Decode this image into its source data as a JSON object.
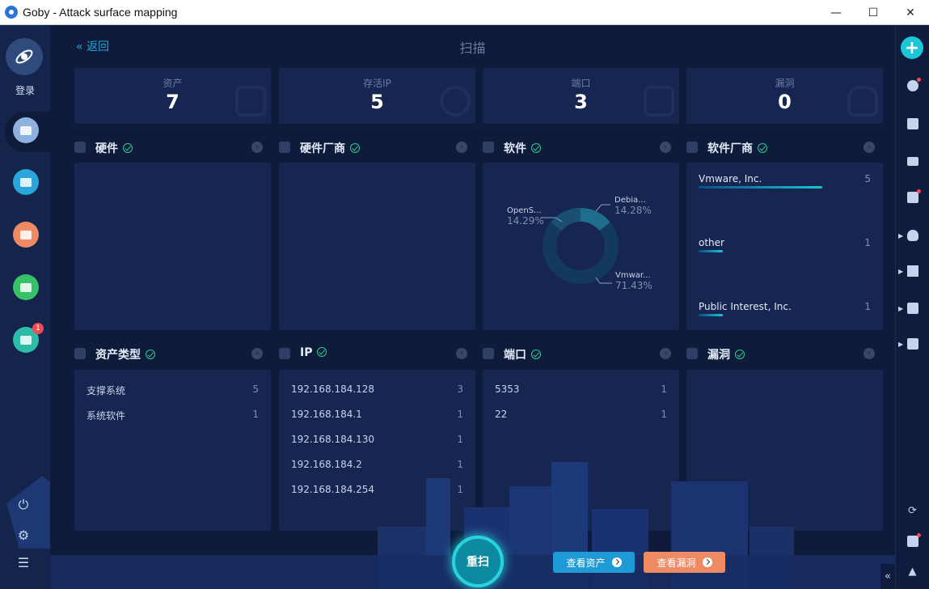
{
  "window": {
    "title": "Goby - Attack surface mapping",
    "minimize": "—",
    "maximize": "☐",
    "close": "✕"
  },
  "sidebar": {
    "login_label": "登录",
    "plugin_badge": "1"
  },
  "header": {
    "back_label": "« 返回",
    "page_title": "扫描"
  },
  "stats": [
    {
      "label": "资产",
      "value": "7",
      "icon": "layers-icon"
    },
    {
      "label": "存活IP",
      "value": "5",
      "icon": "ip-icon"
    },
    {
      "label": "端口",
      "value": "3",
      "icon": "port-icon"
    },
    {
      "label": "漏洞",
      "value": "0",
      "icon": "bug-icon"
    }
  ],
  "panels": {
    "hardware": {
      "title": "硬件"
    },
    "hardware_vendor": {
      "title": "硬件厂商"
    },
    "software": {
      "title": "软件",
      "chart_data": {
        "type": "pie",
        "style": "donut",
        "slices": [
          {
            "label": "Debia...",
            "value": 14.28,
            "display": "14.28%"
          },
          {
            "label": "OpenS...",
            "value": 14.29,
            "display": "14.29%"
          },
          {
            "label": "Vmwar...",
            "value": 71.43,
            "display": "71.43%"
          }
        ],
        "colors": [
          "#1e6d8c",
          "#1a4f73",
          "#133a5e"
        ]
      }
    },
    "software_vendor": {
      "title": "软件厂商",
      "items": [
        {
          "name": "Vmware, Inc.",
          "count": "5",
          "ratio": 0.71
        },
        {
          "name": "other",
          "count": "1",
          "ratio": 0.14
        },
        {
          "name": "Public Interest, Inc.",
          "count": "1",
          "ratio": 0.14
        }
      ]
    },
    "asset_type": {
      "title": "资产类型",
      "rows": [
        {
          "k": "支撑系统",
          "v": "5"
        },
        {
          "k": "系统软件",
          "v": "1"
        }
      ]
    },
    "ip": {
      "title": "IP",
      "rows": [
        {
          "k": "192.168.184.128",
          "v": "3"
        },
        {
          "k": "192.168.184.1",
          "v": "1"
        },
        {
          "k": "192.168.184.130",
          "v": "1"
        },
        {
          "k": "192.168.184.2",
          "v": "1"
        },
        {
          "k": "192.168.184.254",
          "v": "1"
        }
      ]
    },
    "port": {
      "title": "端口",
      "rows": [
        {
          "k": "5353",
          "v": "1"
        },
        {
          "k": "22",
          "v": "1"
        }
      ]
    },
    "vuln": {
      "title": "漏洞"
    }
  },
  "actions": {
    "rescan": "重扫",
    "view_assets": "查看资产",
    "view_vulns": "查看漏洞"
  },
  "colors": {
    "accent": "#1cc6d6",
    "assets_btn": "#1e9bd7",
    "vulns_btn": "#ee8a64",
    "check": "#2ecc8f"
  }
}
